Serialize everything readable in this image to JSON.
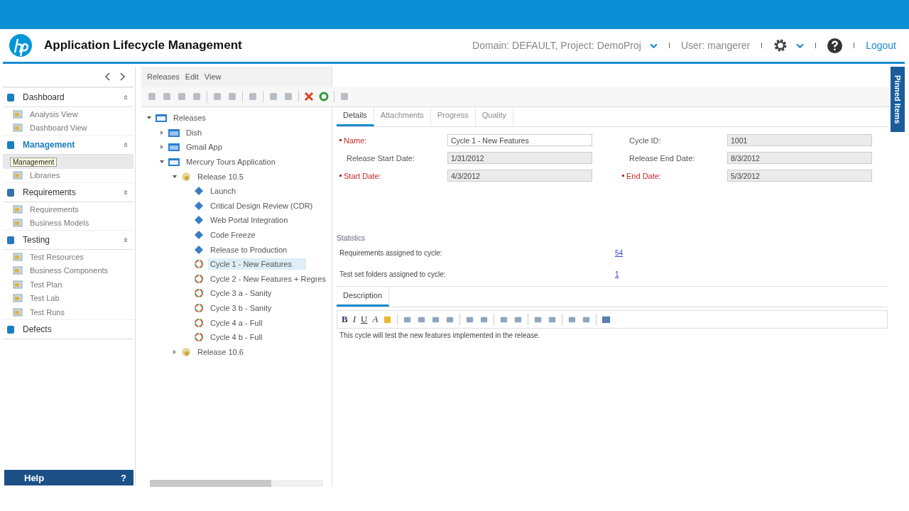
{
  "header": {
    "title": "Application Lifecycle Management",
    "context": "Domain: DEFAULT, Project: DemoProj",
    "user": "User: mangerer",
    "logout": "Logout"
  },
  "sidebar": {
    "sections": [
      {
        "label": "Dashboard",
        "selected": false,
        "items": [
          {
            "label": "Analysis View",
            "selected": false
          },
          {
            "label": "Dashboard View",
            "selected": false
          }
        ]
      },
      {
        "label": "Management",
        "selected": true,
        "items": [
          {
            "selected": true
          },
          {
            "label": "Libraries",
            "selected": false
          }
        ]
      },
      {
        "label": "Requirements",
        "selected": false,
        "items": [
          {
            "label": "Requirements",
            "selected": false
          },
          {
            "label": "Business Models",
            "selected": false
          }
        ]
      },
      {
        "label": "Testing",
        "selected": false,
        "items": [
          {
            "label": "Test Resources",
            "selected": false
          },
          {
            "label": "Business Components",
            "selected": false
          },
          {
            "label": "Test Plan",
            "selected": false
          },
          {
            "label": "Test Lab",
            "selected": false
          },
          {
            "label": "Test Runs",
            "selected": false
          }
        ]
      },
      {
        "label": "Defects",
        "selected": false
      }
    ],
    "tooltip": "Management",
    "help": "Help",
    "help_icon": "?"
  },
  "menu": [
    "Releases",
    "Edit",
    "View"
  ],
  "tree": [
    {
      "label": "Releases",
      "kind": "folder",
      "expanded": true,
      "selected": false,
      "children": [
        {
          "label": "Dish",
          "kind": "folder",
          "expanded": false,
          "selected": false
        },
        {
          "label": "Gmail App",
          "kind": "folder",
          "expanded": false,
          "selected": false
        },
        {
          "label": "Mercury Tours Application",
          "kind": "folder",
          "expanded": true,
          "selected": false,
          "children": [
            {
              "label": "Release 10.5",
              "kind": "release",
              "expanded": true,
              "selected": false,
              "children": [
                {
                  "label": "Launch",
                  "kind": "milestone",
                  "selected": false
                },
                {
                  "label": "Critical Design Review (CDR)",
                  "kind": "milestone",
                  "selected": false
                },
                {
                  "label": "Web Portal Integration",
                  "kind": "milestone",
                  "selected": false
                },
                {
                  "label": "Code Freeze",
                  "kind": "milestone",
                  "selected": false
                },
                {
                  "label": "Release to Production",
                  "kind": "milestone",
                  "selected": false
                },
                {
                  "label": "Cycle 1 - New Features",
                  "kind": "cycle",
                  "selected": true
                },
                {
                  "label": "Cycle 2 - New Features + Regres",
                  "kind": "cycle",
                  "selected": false
                },
                {
                  "label": "Cycle 3 a - Sanity",
                  "kind": "cycle",
                  "selected": false
                },
                {
                  "label": "Cycle 3 b - Sanity",
                  "kind": "cycle",
                  "selected": false
                },
                {
                  "label": "Cycle 4 a - Full",
                  "kind": "cycle",
                  "selected": false
                },
                {
                  "label": "Cycle 4 b - Full",
                  "kind": "cycle",
                  "selected": false
                }
              ]
            },
            {
              "label": "Release 10.6",
              "kind": "release",
              "expanded": false,
              "selected": false
            }
          ]
        }
      ]
    }
  ],
  "tabs": [
    {
      "label": "Details",
      "selected": true
    },
    {
      "label": "Attachments",
      "selected": false
    },
    {
      "label": "Progress",
      "selected": false
    },
    {
      "label": "Quality",
      "selected": false
    }
  ],
  "fields": [
    {
      "label": "Name:",
      "value": "Cycle 1 - New Features",
      "required": true,
      "readonly": false
    },
    {
      "label": "Cycle ID:",
      "value": "1001",
      "required": false,
      "readonly": true
    },
    {
      "label": "Release Start Date:",
      "value": "1/31/2012",
      "required": false,
      "readonly": true
    },
    {
      "label": "Release End Date:",
      "value": "8/3/2012",
      "required": false,
      "readonly": true
    },
    {
      "label": "Start Date:",
      "value": "4/3/2012",
      "required": true,
      "readonly": true
    },
    {
      "label": "End Date:",
      "value": "5/3/2012",
      "required": true,
      "readonly": true
    }
  ],
  "statistics": {
    "title": "Statistics",
    "rows": [
      {
        "label": "Requirements assigned to cycle:",
        "value": "54"
      },
      {
        "label": "Test set folders assigned to cycle:",
        "value": "1"
      }
    ]
  },
  "description_tabs": [
    {
      "label": "Description",
      "selected": true
    }
  ],
  "format_buttons": [
    {
      "label": "B",
      "kind": "bold"
    },
    {
      "label": "I",
      "kind": "italic"
    },
    {
      "label": "U",
      "kind": "underline"
    },
    {
      "label": "A",
      "kind": "color"
    }
  ],
  "description": "This cycle will test the new features implemented in the release.",
  "pinned": "Pinned Items"
}
